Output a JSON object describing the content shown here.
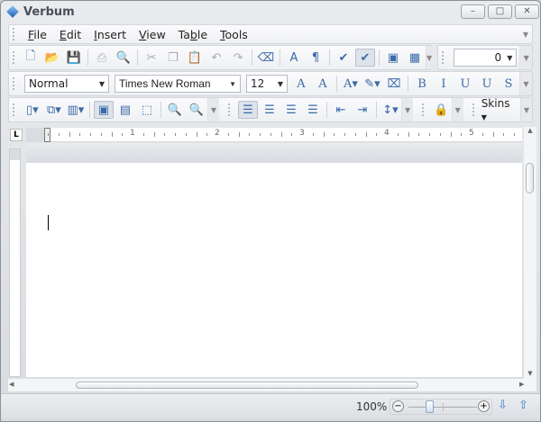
{
  "window": {
    "title": "Verbum",
    "minimize": "–",
    "maximize": "□",
    "close": "✕"
  },
  "menu": [
    {
      "pre": "",
      "u": "F",
      "post": "ile"
    },
    {
      "pre": "",
      "u": "E",
      "post": "dit"
    },
    {
      "pre": "",
      "u": "I",
      "post": "nsert"
    },
    {
      "pre": "",
      "u": "V",
      "post": "iew"
    },
    {
      "pre": "Ta",
      "u": "b",
      "post": "le"
    },
    {
      "pre": "",
      "u": "T",
      "post": "ools"
    }
  ],
  "toolbar1": {
    "icons": [
      {
        "name": "new-document-icon",
        "g": "🗋"
      },
      {
        "name": "open-folder-icon",
        "g": "📂"
      },
      {
        "name": "save-icon",
        "g": "💾",
        "dis": 1
      },
      "|",
      {
        "name": "print-icon",
        "g": "⎙",
        "dis": 1
      },
      {
        "name": "print-preview-icon",
        "g": "🔍",
        "dis": 1
      },
      "|",
      {
        "name": "cut-icon",
        "g": "✂",
        "dis": 1
      },
      {
        "name": "copy-icon",
        "g": "❐",
        "dis": 1
      },
      {
        "name": "paste-icon",
        "g": "📋"
      },
      {
        "name": "undo-icon",
        "g": "↶",
        "dis": 1
      },
      {
        "name": "redo-icon",
        "g": "↷",
        "dis": 1
      },
      "|",
      {
        "name": "eraser-icon",
        "g": "⌫"
      },
      "|",
      {
        "name": "font-icon",
        "g": "A"
      },
      {
        "name": "paragraph-icon",
        "g": "¶"
      },
      "|",
      {
        "name": "spellcheck-icon",
        "g": "✔"
      },
      {
        "name": "auto-spellcheck-icon",
        "g": "✔",
        "act": 1
      },
      "|",
      {
        "name": "insert-image-icon",
        "g": "▣"
      },
      {
        "name": "insert-table-icon",
        "g": "▦"
      }
    ],
    "number_value": "0"
  },
  "toolbar2": {
    "style": "Normal",
    "font": "Times New Roman",
    "size": "12",
    "icons": [
      {
        "name": "grow-font-icon",
        "g": "A"
      },
      {
        "name": "shrink-font-icon",
        "g": "A"
      },
      "|",
      {
        "name": "font-color-icon",
        "g": "A▾"
      },
      {
        "name": "highlight-icon",
        "g": "✎▾"
      },
      {
        "name": "clear-format-icon",
        "g": "⌧"
      },
      "|",
      {
        "name": "bold-icon",
        "g": "B"
      },
      {
        "name": "italic-icon",
        "g": "I"
      },
      {
        "name": "underline-icon",
        "g": "U"
      },
      {
        "name": "double-underline-icon",
        "g": "U"
      },
      {
        "name": "strikethrough-icon",
        "g": "S"
      }
    ]
  },
  "toolbar3": {
    "icons": [
      {
        "name": "page-setup-icon",
        "g": "▯▾"
      },
      {
        "name": "page-orientation-icon",
        "g": "⧉▾"
      },
      {
        "name": "columns-icon",
        "g": "▥▾"
      },
      "|",
      {
        "name": "print-layout-icon",
        "g": "▣",
        "act": 1
      },
      {
        "name": "web-layout-icon",
        "g": "▤"
      },
      {
        "name": "draft-layout-icon",
        "g": "⬚"
      },
      "|",
      {
        "name": "zoom-out-icon",
        "g": "🔍"
      },
      {
        "name": "zoom-in-icon",
        "g": "🔍"
      }
    ],
    "icons2": [
      {
        "name": "align-left-icon",
        "g": "☰",
        "act": 1
      },
      {
        "name": "align-center-icon",
        "g": "☰"
      },
      {
        "name": "align-right-icon",
        "g": "☰"
      },
      {
        "name": "justify-icon",
        "g": "☰"
      },
      "|",
      {
        "name": "decrease-indent-icon",
        "g": "⇤"
      },
      {
        "name": "increase-indent-icon",
        "g": "⇥"
      },
      "|",
      {
        "name": "line-spacing-icon",
        "g": "↕▾"
      }
    ],
    "protect_icon": "lock-document-icon",
    "skins": "Skins"
  },
  "ruler": {
    "tab_stop": "L",
    "numbers": [
      "1",
      "2",
      "3",
      "4",
      "5"
    ]
  },
  "status": {
    "zoom": "100%",
    "zoom_fraction": 0.25,
    "minus": "−",
    "plus": "+"
  }
}
